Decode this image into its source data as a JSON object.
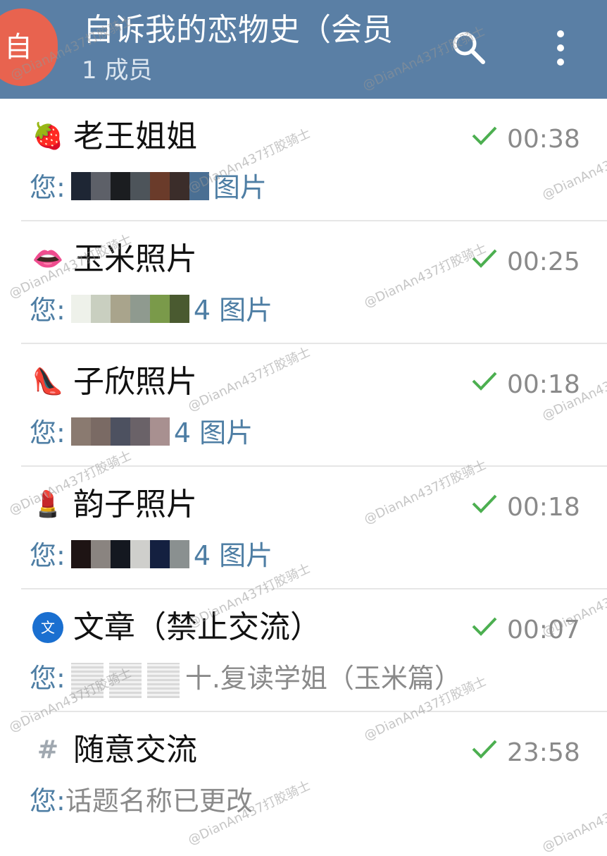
{
  "header": {
    "avatar_letter": "自",
    "title": "自诉我的恋物史（会员",
    "subtitle": "1 成员",
    "search_icon": "search-icon",
    "more_icon": "more-vert-icon"
  },
  "colors": {
    "header_bg": "#5a7fa5",
    "avatar_bg": "#e8634f",
    "check": "#4caf50",
    "accent": "#4e7ea4"
  },
  "chats": [
    {
      "emoji": "🍓",
      "name": "老王姐姐",
      "time": "00:38",
      "you": "您:",
      "media": "图片"
    },
    {
      "emoji": "👄",
      "name": "玉米照片",
      "time": "00:25",
      "you": "您:",
      "media": "4 图片"
    },
    {
      "emoji": "👠",
      "name": "子欣照片",
      "time": "00:18",
      "you": "您:",
      "media": "4 图片"
    },
    {
      "emoji": "💄",
      "name": "韵子照片",
      "time": "00:18",
      "you": "您:",
      "media": "4 图片"
    },
    {
      "emoji": "文",
      "name": "文章（禁止交流）",
      "time": "00:07",
      "you": "您:",
      "text": "十.复读学姐（玉米篇）"
    },
    {
      "emoji": "#",
      "name": "随意交流",
      "time": "23:58",
      "you": "您:",
      "text": "话题名称已更改"
    }
  ],
  "watermark": "@DianAn437打胶骑士"
}
